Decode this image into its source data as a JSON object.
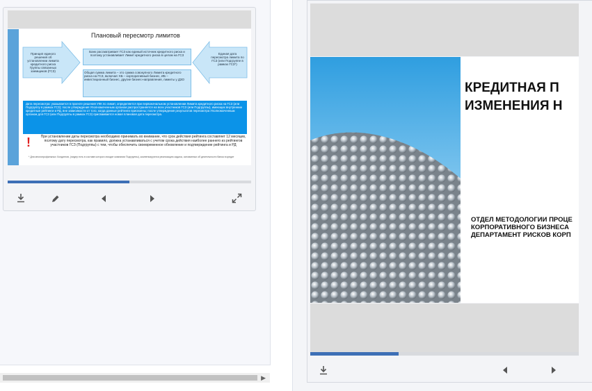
{
  "left_viewer": {
    "slide": {
      "title": "Плановый пересмотр лимитов",
      "box_left": "Принцип единого решения об установлении лимита кредитного риска Группы связанных заемщиков (ГСЗ)",
      "box_center_top": "Банк рассматривает ГСЗ как единый источник кредитного риска и поэтому устанавливает Лимит кредитного риска в целом на ГСЗ",
      "box_center_bottom": "Общая сумма лимита – это сумма совокупного Лимита кредитного риска на ГСЗ, включая: КБ – корпоративный бизнес, ИБ – инвестиционный бизнес, другие бизнес-направления, лимиты у ДЗО",
      "box_right": "Единая дата пересмотра лимита по ГСЗ (или Подгруппе в рамках ГСЗ*)",
      "blue_band": "Дата пересмотра: указывается в проекте решения УКК по лимит, определяется при первоначальном установлении Лимита кредитного риска на ГСЗ (или Подгруппу в рамках ГСЗ); после утверждения Уполномоченным органом распространяется на всех участников ГСЗ (или Подгруппы), имеющих внутренние кредитные рейтинги и РД, вне зависимости от того, когда данные рейтинги присвоены; после утверждения результатов пересмотра Уполномоченным органом для ГСЗ (или Подгруппы в рамках ГСЗ) присваивается новая плановая дата пересмотра.",
      "bottom_text": "При установлении даты пересмотра необходимо принимать во внимание, что срок действия рейтинга составляет 12 месяцев, поэтому дату пересмотра, как правило, должна устанавливаться с учетом срока действия наиболее раннего из рейтингов участников ГСЗ (Подгруппы) с тем, чтобы обеспечить своевременное обновление и подтверждение рейтинга и РД",
      "exclamation": "!",
      "footnote": "* Для многопрофильных Холдингов, (лидер есть в составе которого входят компании Подгруппы), компенсируются реализацию задача, основанных об деятельности банка в кредит"
    },
    "progress": 0.5,
    "controls": {
      "download_icon": "download-icon",
      "edit_icon": "pencil-icon",
      "prev_icon": "caret-left-icon",
      "next_icon": "caret-right-icon",
      "expand_icon": "expand-icon"
    }
  },
  "right_viewer": {
    "slide": {
      "title_line1": "КРЕДИТНАЯ П",
      "title_line2": "ИЗМЕНЕНИЯ Н",
      "sub_line1": "ОТДЕЛ МЕТОДОЛОГИИ ПРОЦЕ",
      "sub_line2": "КОРПОРАТИВНОГО БИЗНЕСА",
      "sub_line3": "ДЕПАРТАМЕНТ РИСКОВ КОРП"
    },
    "progress": 0.33,
    "controls": {
      "download_icon": "download-icon",
      "prev_icon": "caret-left-icon",
      "next_icon": "caret-right-icon"
    }
  },
  "colors": {
    "accent": "#3d6fb6",
    "slide_blue": "#0b93e8",
    "slide_light_blue": "#c9e6f8"
  }
}
